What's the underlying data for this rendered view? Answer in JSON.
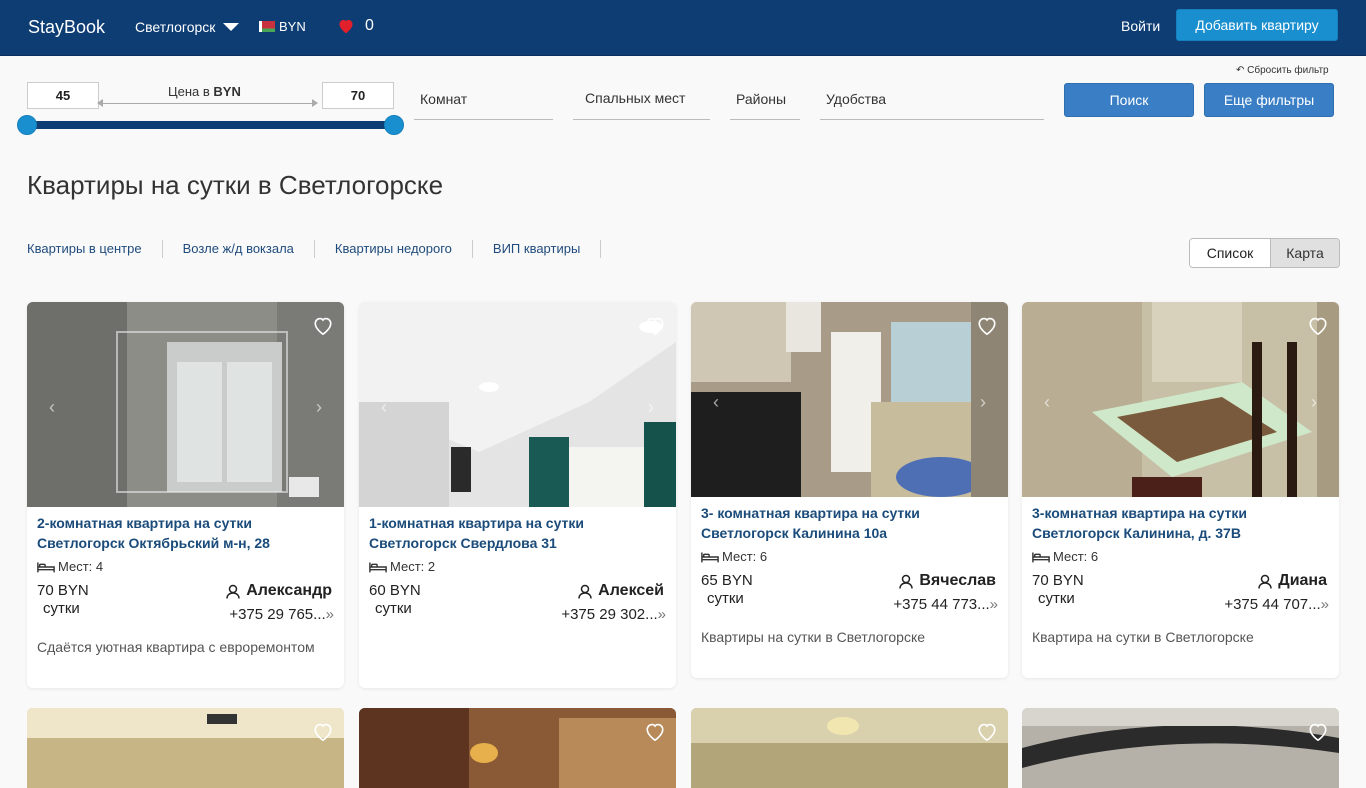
{
  "header": {
    "logo": "StayBook",
    "city": "Светлогорск",
    "currency": "BYN",
    "favorites_count": "0",
    "login": "Войти",
    "add_button": "Добавить квартиру"
  },
  "filters": {
    "reset": "Сбросить фильтр",
    "price_min": "45",
    "price_max": "70",
    "price_label_prefix": "Цена в",
    "price_label_currency": "BYN",
    "rooms": "Комнат",
    "beds": "Спальных мест",
    "districts": "Районы",
    "amenities": "Удобства",
    "search_button": "Поиск",
    "more_filters_button": "Еще фильтры"
  },
  "page_title": "Квартиры на сутки в Светлогорске",
  "quick_links": [
    "Квартиры в центре",
    "Возле ж/д вокзала",
    "Квартиры недорого",
    "ВИП квартиры"
  ],
  "view_toggle": {
    "list": "Список",
    "map": "Карта"
  },
  "listings": [
    {
      "title": "2-комнатная квартира на сутки Светлогорск Октябрьский м-н, 28",
      "beds": "Мест: 4",
      "price": "70 BYN",
      "per": "сутки",
      "owner": "Александр",
      "phone": "+375 29 765...",
      "description": "Сдаётся уютная квартира с евроремонтом"
    },
    {
      "title": "1-комнатная квартира на сутки Светлогорск Свердлова 31",
      "beds": "Мест: 2",
      "price": "60 BYN",
      "per": "сутки",
      "owner": "Алексей",
      "phone": "+375 29 302...",
      "description": ""
    },
    {
      "title": "3- комнатная квартира на сутки Светлогорск Калинина 10а",
      "beds": "Мест: 6",
      "price": "65 BYN",
      "per": "сутки",
      "owner": "Вячеслав",
      "phone": "+375 44 773...",
      "description": "Квартиры на сутки в Светлогорске"
    },
    {
      "title": "3-комнатная квартира на сутки Светлогорск Калинина, д. 37В",
      "beds": "Мест: 6",
      "price": "70 BYN",
      "per": "сутки",
      "owner": "Диана",
      "phone": "+375 44 707...",
      "description": "Квартира на сутки в Светлогорске"
    }
  ],
  "colors": {
    "header_bg": "#0e3d74",
    "accent": "#1a8fd0",
    "button_blue": "#3a7fc6",
    "heart_red": "#e0202a"
  }
}
